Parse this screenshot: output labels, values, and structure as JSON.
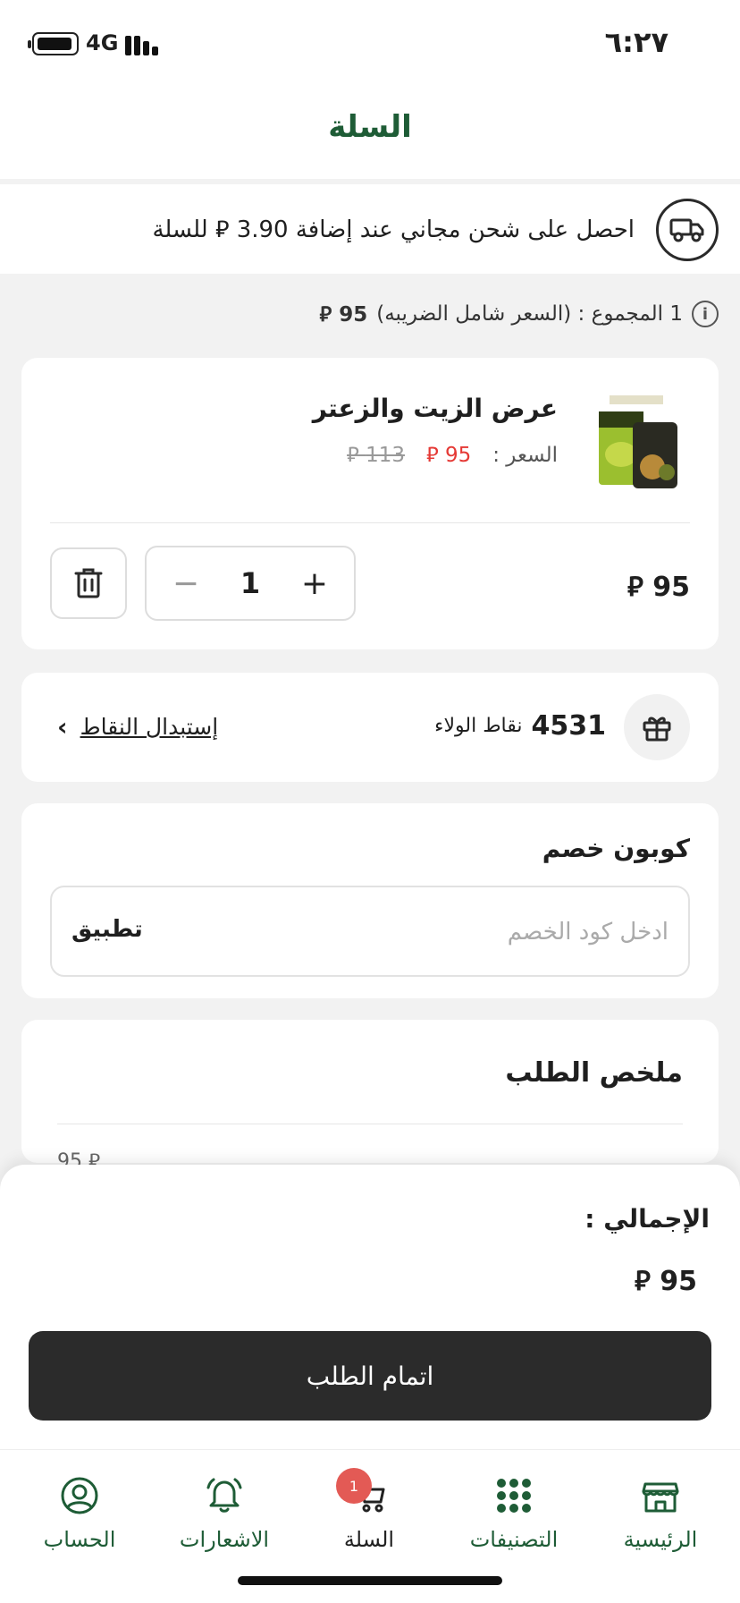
{
  "status_bar": {
    "time": "٦:٢٧",
    "network": "4G"
  },
  "header": {
    "title": "السلة"
  },
  "shipping_banner": {
    "text": "احصل على شحن مجاني عند إضافة 3.90 ⃁ للسلة"
  },
  "cart_info": {
    "text": "1 المجموع : (السعر شامل الضريبه)",
    "amount": "95 ⃁"
  },
  "cart_item": {
    "name": "عرض الزيت والزعتر",
    "price_label": "السعر :",
    "price": "95 ⃁",
    "old_price": "113 ⃁",
    "quantity": "1",
    "line_total": "95 ⃁"
  },
  "loyalty": {
    "points": "4531",
    "points_label": "نقاط الولاء",
    "redeem_label": "إستبدال النقاط"
  },
  "coupon": {
    "title": "كوبون خصم",
    "placeholder": "ادخل كود الخصم",
    "apply_label": "تطبيق"
  },
  "summary": {
    "title": "ملخص الطلب",
    "subtotal_value": "95 ⃁"
  },
  "checkout": {
    "total_label": "الإجمالي :",
    "total_value": "95 ⃁",
    "button_label": "اتمام الطلب"
  },
  "bottom_nav": {
    "items": [
      {
        "label": "الرئيسية",
        "icon": "store-icon"
      },
      {
        "label": "التصنيفات",
        "icon": "grid-icon"
      },
      {
        "label": "السلة",
        "icon": "cart-icon",
        "badge": "1"
      },
      {
        "label": "الاشعارات",
        "icon": "bell-icon"
      },
      {
        "label": "الحساب",
        "icon": "user-icon"
      }
    ]
  },
  "colors": {
    "brand_green": "#1e5c36",
    "sale_red": "#e53935",
    "checkout_dark": "#2b2b2b",
    "badge": "#e35a55"
  }
}
